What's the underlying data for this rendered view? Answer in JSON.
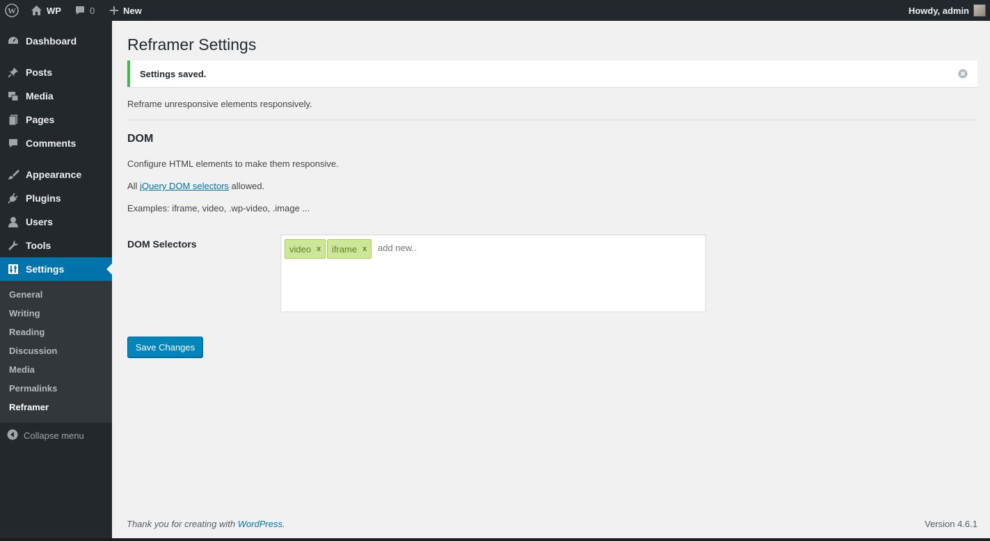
{
  "adminbar": {
    "site_name": "WP",
    "comments_count": "0",
    "new_label": "New",
    "greeting": "Howdy, admin"
  },
  "sidebar": {
    "items": [
      {
        "label": "Dashboard",
        "icon": "dashboard-icon"
      },
      {
        "label": "Posts",
        "icon": "pin-icon"
      },
      {
        "label": "Media",
        "icon": "media-icon"
      },
      {
        "label": "Pages",
        "icon": "pages-icon"
      },
      {
        "label": "Comments",
        "icon": "comment-icon"
      },
      {
        "label": "Appearance",
        "icon": "brush-icon"
      },
      {
        "label": "Plugins",
        "icon": "plug-icon"
      },
      {
        "label": "Users",
        "icon": "user-icon"
      },
      {
        "label": "Tools",
        "icon": "wrench-icon"
      },
      {
        "label": "Settings",
        "icon": "settings-icon"
      }
    ],
    "submenu": [
      "General",
      "Writing",
      "Reading",
      "Discussion",
      "Media",
      "Permalinks",
      "Reframer"
    ],
    "collapse_label": "Collapse menu"
  },
  "page": {
    "title": "Reframer Settings",
    "notice": "Settings saved.",
    "intro": "Reframe unresponsive elements responsively.",
    "section_title": "DOM",
    "para1": "Configure HTML elements to make them responsive.",
    "para2_prefix": "All ",
    "para2_link": "jQuery DOM selectors",
    "para2_suffix": " allowed.",
    "para3": "Examples: iframe, video, .wp-video, .image ...",
    "field_label": "DOM Selectors",
    "tags": [
      "video",
      "iframe"
    ],
    "tag_remove": "x",
    "tag_placeholder": "add new..",
    "save_button": "Save Changes"
  },
  "footer": {
    "thanks_prefix": "Thank you for creating with ",
    "thanks_link": "WordPress",
    "thanks_suffix": ".",
    "version": "Version 4.6.1"
  },
  "colors": {
    "admin_dark": "#23282d",
    "accent_blue": "#0073aa",
    "button_blue": "#0085ba",
    "notice_green": "#46b450",
    "tag_green": "#cde69c"
  }
}
